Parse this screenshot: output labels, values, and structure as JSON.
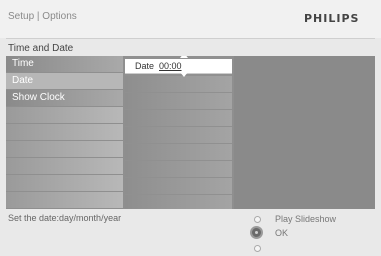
{
  "header": {
    "breadcrumb": "Setup | Options",
    "brand": "PHILIPS",
    "section_title": "Time and Date"
  },
  "menu": {
    "items": [
      {
        "label": "Time"
      },
      {
        "label": "Date"
      },
      {
        "label": "Show Clock"
      }
    ]
  },
  "editor": {
    "field_label": "Date",
    "field_value": "00:00"
  },
  "footer": {
    "hint": "Set the date:day/month/year",
    "action_up": "Play Slideshow",
    "action_ok": "OK"
  },
  "colors": {
    "panel": "#8f8f8f",
    "selected": "#b7b7b7",
    "header_bg": "#f1f1f1"
  },
  "icons": {
    "nav": "nav-wheel-icon",
    "up": "up-arrow-icon",
    "down": "down-arrow-icon"
  }
}
